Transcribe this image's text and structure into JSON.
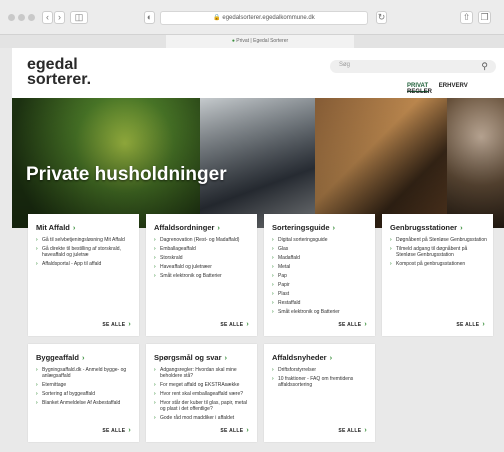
{
  "browser": {
    "url": "egedalsorterer.egedalkommune.dk",
    "tab_title": "Privat | Egedal Sorterer"
  },
  "header": {
    "logo_line1": "egedal",
    "logo_line2": "sorterer.",
    "search_placeholder": "Søg",
    "nav": [
      "PRIVAT",
      "ERHVERV",
      "REGLER"
    ]
  },
  "hero": {
    "title": "Private husholdninger"
  },
  "see_all_label": "SE ALLE",
  "cards": [
    {
      "title": "Mit Affald",
      "items": [
        "Gå til selvbetjeningsløsning Mit Affald",
        "Gå direkte til bestilling af storskrald, haveaffald og juletræ",
        "Affaldsportal - App til affald"
      ]
    },
    {
      "title": "Affaldsordninger",
      "items": [
        "Dagrenovation (Rest- og Madaffald)",
        "Emballageaffald",
        "Storskrald",
        "Haveaffald og juletræer",
        "Småt elektronik og Batterier"
      ]
    },
    {
      "title": "Sorteringsguide",
      "items": [
        "Digital sorteringsguide",
        "Glas",
        "Madaffald",
        "Metal",
        "Pap",
        "Papir",
        "Plast",
        "Restaffald",
        "Småt elektronik og Batterier"
      ]
    },
    {
      "title": "Genbrugsstationer",
      "items": [
        "Døgnåbent på Stenløse Genbrugsstation",
        "Tilmeld adgang til døgnåbent på Stenløse Genbrugsstation",
        "Kompost på genbrugsstationen"
      ]
    },
    {
      "title": "Byggeaffald",
      "items": [
        "Bygningsaffald.dk - Anmeld bygge- og anlægsaffald",
        "Eternittage",
        "Sortering af byggeaffald",
        "Blanket Anmeldelse Af Asbestaffald"
      ]
    },
    {
      "title": "Spørgsmål og svar",
      "items": [
        "Adgangsregler: Hvordan skal mine beholdere stå?",
        "For meget affald og EKSTRAsække",
        "Hvor rent skal emballageaffald være?",
        "Hvor står der kuber til glas, papir, metal og plast i det offentlige?",
        "Gode råd mod maddiker i affaldet"
      ]
    },
    {
      "title": "Affaldsnyheder",
      "items": [
        "Driftsforstyrrelser",
        "10 fraktioner - FAQ om fremtidens affaldssortering"
      ]
    }
  ]
}
